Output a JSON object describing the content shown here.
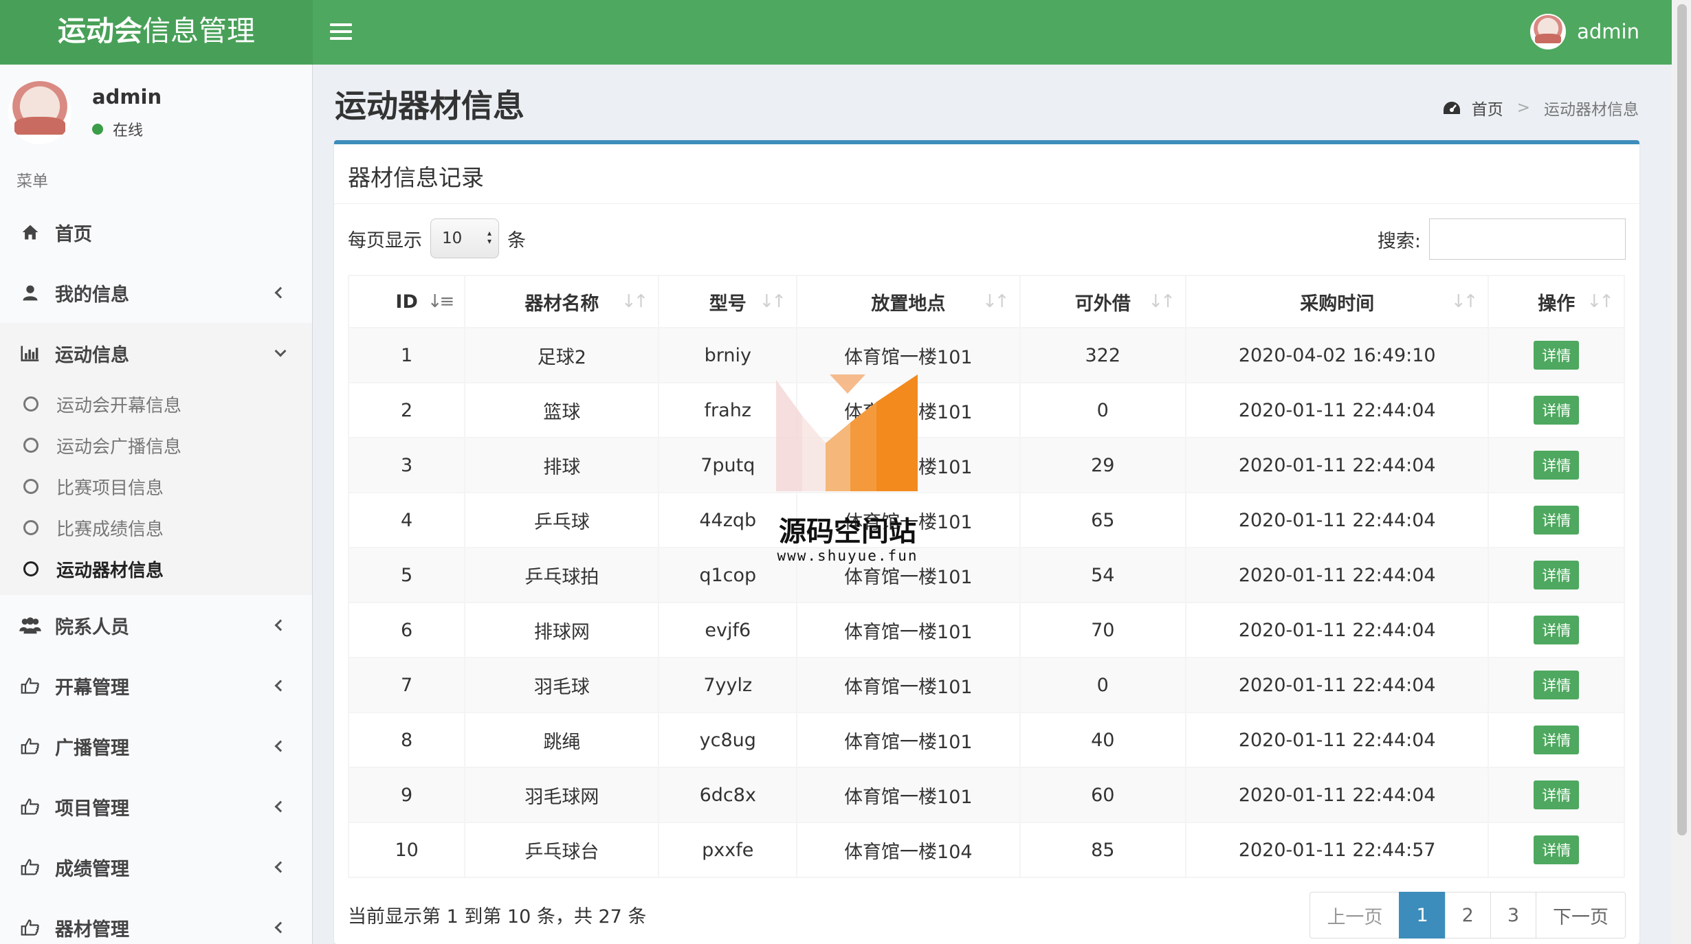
{
  "app": {
    "title_bold": "运动会",
    "title_rest": "信息管理"
  },
  "header": {
    "user_name": "admin"
  },
  "sidebar": {
    "user_name": "admin",
    "status": "在线",
    "menu_header": "菜单",
    "items": [
      {
        "label": "首页",
        "icon": "home-icon"
      },
      {
        "label": "我的信息",
        "icon": "user-icon"
      },
      {
        "label": "运动信息",
        "icon": "bar-chart-icon",
        "open": true,
        "sub": [
          "运动会开幕信息",
          "运动会广播信息",
          "比赛项目信息",
          "比赛成绩信息",
          "运动器材信息"
        ],
        "active_sub": "运动器材信息"
      },
      {
        "label": "院系人员",
        "icon": "users-icon"
      },
      {
        "label": "开幕管理",
        "icon": "thumbs-up-icon"
      },
      {
        "label": "广播管理",
        "icon": "thumbs-up-icon"
      },
      {
        "label": "项目管理",
        "icon": "thumbs-up-icon"
      },
      {
        "label": "成绩管理",
        "icon": "thumbs-up-icon"
      },
      {
        "label": "器材管理",
        "icon": "thumbs-up-icon"
      }
    ]
  },
  "page": {
    "title": "运动器材信息",
    "breadcrumb": {
      "home": "首页",
      "sep": ">",
      "current": "运动器材信息"
    }
  },
  "box": {
    "title": "器材信息记录",
    "length_prefix": "每页显示",
    "length_value": "10",
    "length_suffix": "条",
    "search_label": "搜索:",
    "search_value": ""
  },
  "table": {
    "columns": [
      "ID",
      "器材名称",
      "型号",
      "放置地点",
      "可外借",
      "采购时间",
      "操作"
    ],
    "action_label": "详情",
    "rows": [
      [
        "1",
        "足球2",
        "brniy",
        "体育馆一楼101",
        "322",
        "2020-04-02 16:49:10"
      ],
      [
        "2",
        "篮球",
        "frahz",
        "体育馆一楼101",
        "0",
        "2020-01-11 22:44:04"
      ],
      [
        "3",
        "排球",
        "7putq",
        "体育馆一楼101",
        "29",
        "2020-01-11 22:44:04"
      ],
      [
        "4",
        "乒乓球",
        "44zqb",
        "体育馆一楼101",
        "65",
        "2020-01-11 22:44:04"
      ],
      [
        "5",
        "乒乓球拍",
        "q1cop",
        "体育馆一楼101",
        "54",
        "2020-01-11 22:44:04"
      ],
      [
        "6",
        "排球网",
        "evjf6",
        "体育馆一楼101",
        "70",
        "2020-01-11 22:44:04"
      ],
      [
        "7",
        "羽毛球",
        "7yylz",
        "体育馆一楼101",
        "0",
        "2020-01-11 22:44:04"
      ],
      [
        "8",
        "跳绳",
        "yc8ug",
        "体育馆一楼101",
        "40",
        "2020-01-11 22:44:04"
      ],
      [
        "9",
        "羽毛球网",
        "6dc8x",
        "体育馆一楼101",
        "60",
        "2020-01-11 22:44:04"
      ],
      [
        "10",
        "乒乓球台",
        "pxxfe",
        "体育馆一楼104",
        "85",
        "2020-01-11 22:44:57"
      ]
    ]
  },
  "footer": {
    "info": "当前显示第 1 到第 10 条，共 27 条",
    "prev": "上一页",
    "pages": [
      "1",
      "2",
      "3"
    ],
    "active_page": "1",
    "next": "下一页"
  },
  "watermark": {
    "name": "源码空间站",
    "url": "www.shuyue.fun"
  },
  "colors": {
    "header": "#4ea85f",
    "logo_bg": "#48a058",
    "box_border": "#3c8dbc",
    "detail_button": "#4ea85f",
    "active_page": "#3c8dbc"
  }
}
